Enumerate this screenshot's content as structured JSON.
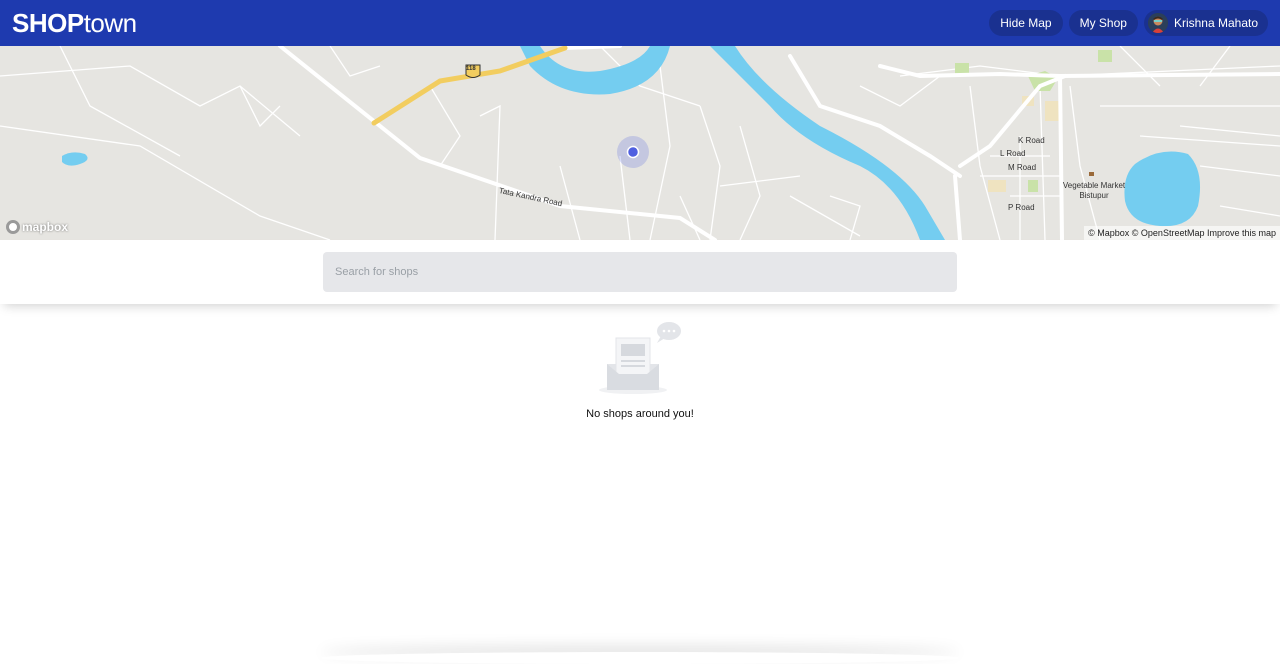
{
  "header": {
    "logo_bold": "SHOP",
    "logo_light": "town",
    "hide_map_label": "Hide Map",
    "my_shop_label": "My Shop",
    "user_name": "Krishna Mahato"
  },
  "map": {
    "labels": {
      "road_tata_kandra": "Tata Kandra Road",
      "highway_shield": "118",
      "k_road": "K Road",
      "l_road": "L Road",
      "m_road": "M Road",
      "p_road": "P Road",
      "vegetable_market": "Vegetable Market Bistupur"
    },
    "mapbox_logo": "mapbox",
    "attribution": "© Mapbox © OpenStreetMap Improve this map"
  },
  "search": {
    "placeholder": "Search for shops",
    "value": ""
  },
  "empty_state": {
    "message": "No shops around you!"
  },
  "colors": {
    "header_bg": "#1e3aaf",
    "pill_bg": "#1a3190",
    "map_bg": "#e6e5e1",
    "water": "#74cdf0",
    "highway": "#f2cd5f",
    "location_dot": "#4f5fe0"
  },
  "icons": {
    "location": "user-location-dot",
    "empty": "empty-inbox-illustration"
  }
}
